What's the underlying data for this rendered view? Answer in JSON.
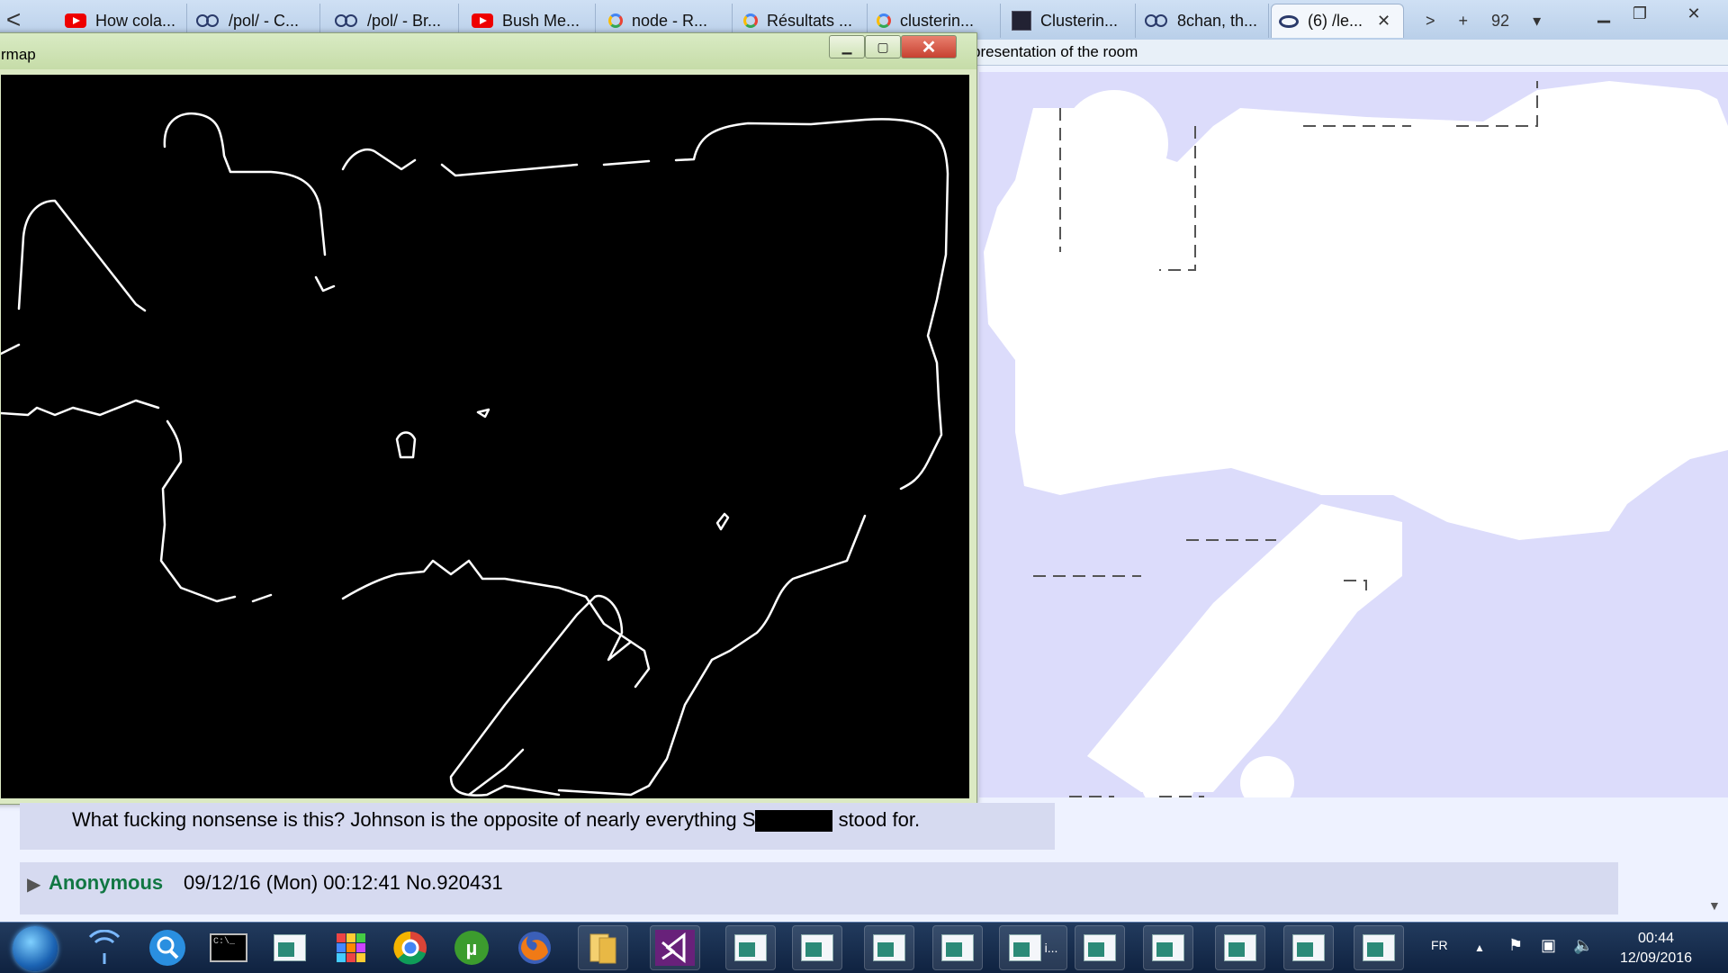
{
  "browser": {
    "tabs": [
      {
        "icon": "youtube-icon",
        "title": "How cola..."
      },
      {
        "icon": "8chan-icon",
        "title": "/pol/ - C..."
      },
      {
        "icon": "8chan-icon",
        "title": "/pol/ - Br..."
      },
      {
        "icon": "youtube-icon",
        "title": "Bush Me..."
      },
      {
        "icon": "google-icon",
        "title": "node - R..."
      },
      {
        "icon": "google-icon",
        "title": "Résultats ..."
      },
      {
        "icon": "google-icon",
        "title": "clusterin..."
      },
      {
        "icon": "page-icon",
        "title": "Clusterin..."
      },
      {
        "icon": "8chan-icon",
        "title": "8chan, th..."
      },
      {
        "icon": "eye-icon",
        "title": "(6) /le...",
        "active": true
      }
    ],
    "tab_count": "92",
    "new_tab": "+",
    "back": "<",
    "forward": ">",
    "dropdown": "▾"
  },
  "left_window": {
    "title": "rmap",
    "minimize": "▁",
    "maximize": "▢",
    "close": "✕"
  },
  "right_window": {
    "title": "presentation of the room"
  },
  "forum": {
    "post_text_before": "What fucking nonsense is this?  Johnson is the opposite of nearly everything S",
    "post_text_after": " stood for.",
    "reply_name": "Anonymous",
    "reply_meta": "09/12/16 (Mon) 00:12:41 No.920431",
    "reply_arrow": "▶"
  },
  "taskbar": {
    "language": "FR",
    "time": "00:44",
    "date": "12/09/2016",
    "tray_up": "▲",
    "label_i": "i..."
  },
  "colors": {
    "room_background": "#dcdcfb",
    "edge_background": "#000000",
    "edge_lines": "#ffffff",
    "anon_name": "#117743"
  }
}
